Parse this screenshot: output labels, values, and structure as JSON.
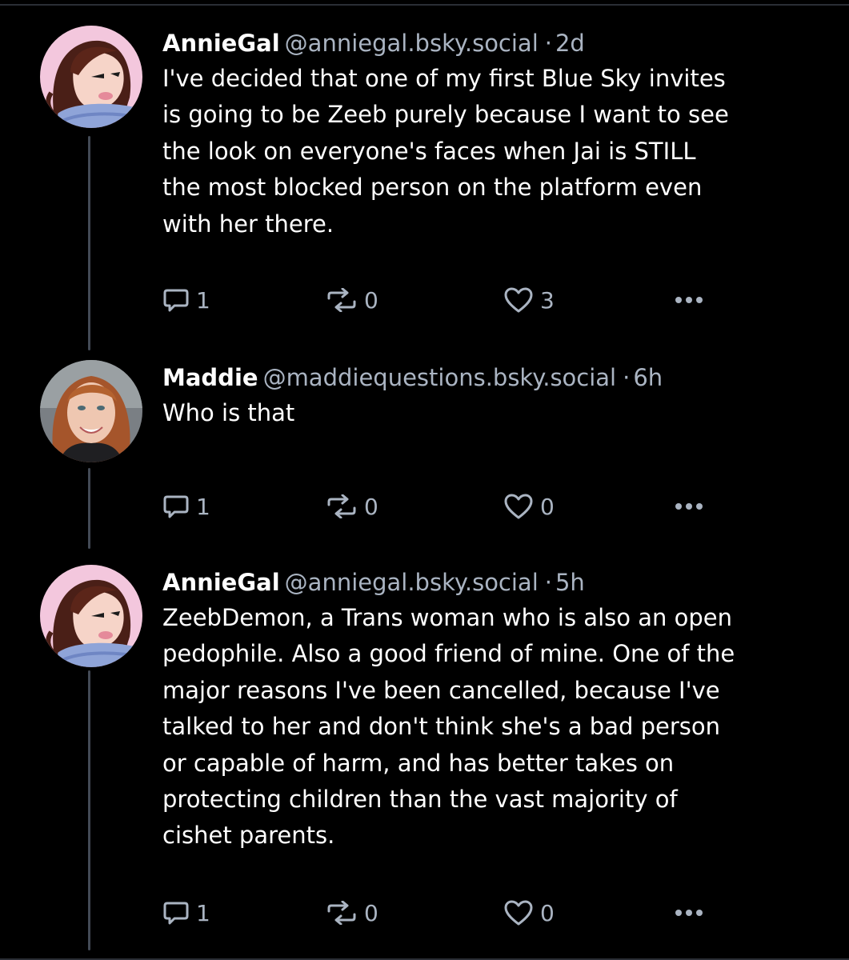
{
  "posts": [
    {
      "author": "AnnieGal",
      "handle": "@anniegal.bsky.social",
      "separator": "·",
      "time": "2d",
      "text": "I've decided that one of my first Blue Sky invites\nis going to be Zeeb purely because I want to see\nthe look on everyone's faces when Jai is STILL\nthe most blocked person on the platform even\nwith her there.",
      "replies": "1",
      "reposts": "0",
      "likes": "3",
      "avatar": "anniegal-avatar"
    },
    {
      "author": "Maddie",
      "handle": "@maddiequestions.bsky.social",
      "separator": "·",
      "time": "6h",
      "text": "Who is that",
      "replies": "1",
      "reposts": "0",
      "likes": "0",
      "avatar": "maddie-avatar"
    },
    {
      "author": "AnnieGal",
      "handle": "@anniegal.bsky.social",
      "separator": "·",
      "time": "5h",
      "text": "ZeebDemon, a Trans woman who is also an open\npedophile. Also a good friend of mine. One of the\nmajor reasons I've been cancelled, because I've\ntalked to her and don't think she's a bad person\nor capable of harm, and has better takes on\nprotecting children than the vast majority of\ncishet parents.",
      "replies": "1",
      "reposts": "0",
      "likes": "0",
      "avatar": "anniegal-avatar"
    }
  ],
  "icons": {
    "reply": "reply-bubble-icon",
    "repost": "repost-arrows-icon",
    "like": "heart-icon",
    "more": "more-dots-icon"
  },
  "colors": {
    "background": "#000000",
    "text_primary": "#ffffff",
    "text_secondary": "#aab4c2",
    "thread_line": "#434a56"
  }
}
